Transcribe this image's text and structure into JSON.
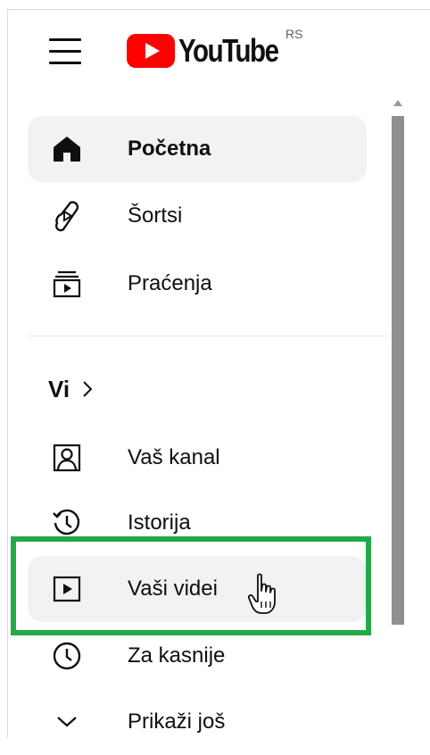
{
  "header": {
    "brand": "YouTube",
    "region": "RS"
  },
  "sidebar": {
    "items": [
      {
        "label": "Početna",
        "icon": "home-icon",
        "active": true
      },
      {
        "label": "Šortsi",
        "icon": "shorts-icon"
      },
      {
        "label": "Praćenja",
        "icon": "subscriptions-icon"
      }
    ],
    "you_section": {
      "title": "Vi",
      "items": [
        {
          "label": "Vaš kanal",
          "icon": "your-channel-icon"
        },
        {
          "label": "Istorija",
          "icon": "history-icon"
        },
        {
          "label": "Vaši videi",
          "icon": "your-videos-icon",
          "hovered": true,
          "highlighted": true
        },
        {
          "label": "Za kasnije",
          "icon": "watch-later-icon"
        },
        {
          "label": "Prikaži još",
          "icon": "chevron-down-icon"
        }
      ]
    }
  },
  "colors": {
    "brand_red": "#ff0000",
    "highlight_green": "#22aa47",
    "active_bg": "#f2f2f2"
  }
}
